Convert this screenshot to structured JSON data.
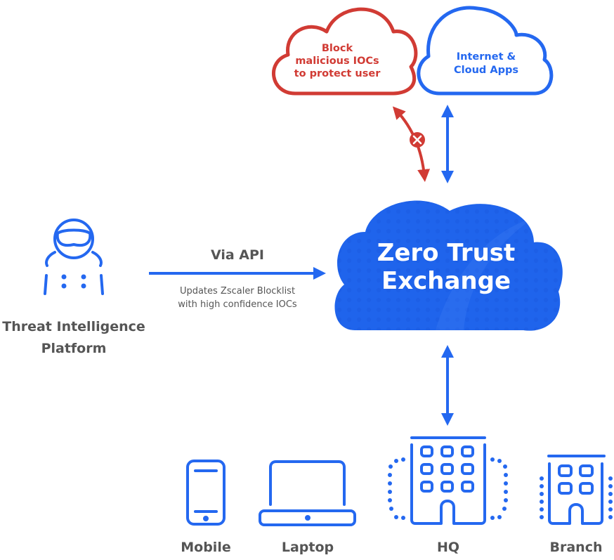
{
  "colors": {
    "blue": "#2468f0",
    "red": "#d13b34",
    "gray_text": "#555555",
    "cloud_fill": "#1f64ec"
  },
  "clouds": {
    "block": {
      "lines": [
        "Block",
        "malicious IOCs",
        "to protect user"
      ],
      "icon": "cloud-outline-icon"
    },
    "internet": {
      "lines": [
        "Internet &",
        "Cloud Apps"
      ],
      "icon": "cloud-outline-icon"
    },
    "zte": {
      "lines": [
        "Zero Trust",
        "Exchange"
      ],
      "icon": "cloud-filled-icon"
    }
  },
  "threat_platform": {
    "lines": [
      "Threat Intelligence",
      "Platform"
    ],
    "icon": "hacker-icon"
  },
  "api_link": {
    "title": "Via API",
    "caption_lines": [
      "Updates Zscaler Blocklist",
      "with high confidence IOCs"
    ]
  },
  "blocked_marker": {
    "icon": "blocked-x-icon"
  },
  "endpoints": [
    {
      "label": "Mobile",
      "icon": "mobile-phone-icon"
    },
    {
      "label": "Laptop",
      "icon": "laptop-icon"
    },
    {
      "label": "HQ",
      "icon": "hq-building-icon"
    },
    {
      "label": "Branch",
      "icon": "branch-building-icon"
    }
  ]
}
